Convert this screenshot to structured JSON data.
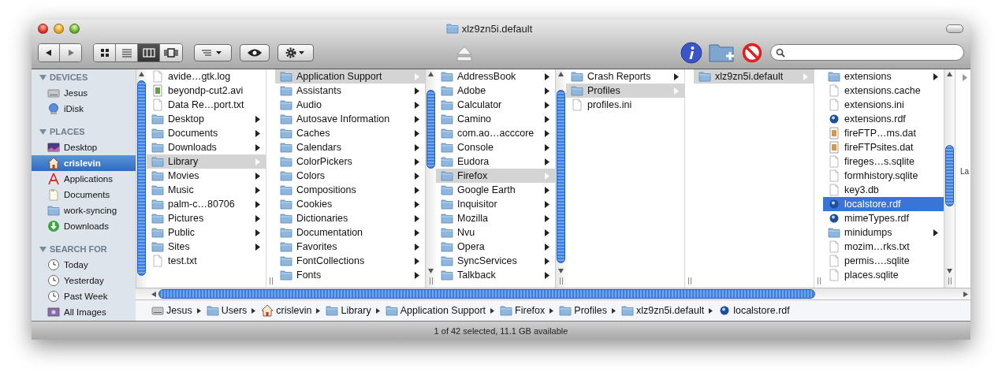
{
  "window": {
    "title": "xlz9zn5i.default"
  },
  "toolbar": {
    "view_modes": [
      {
        "kind": "icons",
        "selected": false
      },
      {
        "kind": "list",
        "selected": false
      },
      {
        "kind": "columns",
        "selected": true
      },
      {
        "kind": "coverflow",
        "selected": false
      }
    ]
  },
  "sidebar": {
    "sections": [
      {
        "title": "DEVICES",
        "expanded": true,
        "items": [
          {
            "label": "Jesus",
            "kind": "drive",
            "selected": false
          },
          {
            "label": "iDisk",
            "kind": "idisk",
            "selected": false
          }
        ]
      },
      {
        "title": "PLACES",
        "expanded": true,
        "items": [
          {
            "label": "Desktop",
            "kind": "desktop",
            "selected": false
          },
          {
            "label": "crislevin",
            "kind": "home",
            "selected": true
          },
          {
            "label": "Applications",
            "kind": "apps",
            "selected": false
          },
          {
            "label": "Documents",
            "kind": "docs",
            "selected": false
          },
          {
            "label": "work-syncing",
            "kind": "folder",
            "selected": false
          },
          {
            "label": "Downloads",
            "kind": "download",
            "selected": false
          }
        ]
      },
      {
        "title": "SEARCH FOR",
        "expanded": true,
        "items": [
          {
            "label": "Today",
            "kind": "clock",
            "selected": false
          },
          {
            "label": "Yesterday",
            "kind": "clock",
            "selected": false
          },
          {
            "label": "Past Week",
            "kind": "clock",
            "selected": false
          },
          {
            "label": "All Images",
            "kind": "images",
            "selected": false
          }
        ]
      }
    ]
  },
  "columns": [
    {
      "focused": false,
      "items": [
        {
          "name": "avide…gtk.log",
          "kind": "file",
          "expandable": false,
          "selected": false
        },
        {
          "name": "beyondp-cut2.avi",
          "kind": "movie",
          "expandable": false,
          "selected": false
        },
        {
          "name": "Data Re…port.txt",
          "kind": "file",
          "expandable": false,
          "selected": false
        },
        {
          "name": "Desktop",
          "kind": "folder",
          "expandable": true,
          "selected": false
        },
        {
          "name": "Documents",
          "kind": "folder",
          "expandable": true,
          "selected": false
        },
        {
          "name": "Downloads",
          "kind": "folder",
          "expandable": true,
          "selected": false
        },
        {
          "name": "Library",
          "kind": "folder",
          "expandable": true,
          "selected": true
        },
        {
          "name": "Movies",
          "kind": "folder",
          "expandable": true,
          "selected": false
        },
        {
          "name": "Music",
          "kind": "folder",
          "expandable": true,
          "selected": false
        },
        {
          "name": "palm-c…80706",
          "kind": "folder",
          "expandable": true,
          "selected": false
        },
        {
          "name": "Pictures",
          "kind": "folder",
          "expandable": true,
          "selected": false
        },
        {
          "name": "Public",
          "kind": "folder",
          "expandable": true,
          "selected": false
        },
        {
          "name": "Sites",
          "kind": "folder",
          "expandable": true,
          "selected": false
        },
        {
          "name": "test.txt",
          "kind": "file",
          "expandable": false,
          "selected": false
        }
      ]
    },
    {
      "focused": false,
      "items": [
        {
          "name": "Application Support",
          "kind": "folder",
          "expandable": true,
          "selected": true
        },
        {
          "name": "Assistants",
          "kind": "folder",
          "expandable": true,
          "selected": false
        },
        {
          "name": "Audio",
          "kind": "folder",
          "expandable": true,
          "selected": false
        },
        {
          "name": "Autosave Information",
          "kind": "folder",
          "expandable": true,
          "selected": false
        },
        {
          "name": "Caches",
          "kind": "folder",
          "expandable": true,
          "selected": false
        },
        {
          "name": "Calendars",
          "kind": "folder",
          "expandable": true,
          "selected": false
        },
        {
          "name": "ColorPickers",
          "kind": "folder",
          "expandable": true,
          "selected": false
        },
        {
          "name": "Colors",
          "kind": "folder",
          "expandable": true,
          "selected": false
        },
        {
          "name": "Compositions",
          "kind": "folder",
          "expandable": true,
          "selected": false
        },
        {
          "name": "Cookies",
          "kind": "folder",
          "expandable": true,
          "selected": false
        },
        {
          "name": "Dictionaries",
          "kind": "folder",
          "expandable": true,
          "selected": false
        },
        {
          "name": "Documentation",
          "kind": "folder",
          "expandable": true,
          "selected": false
        },
        {
          "name": "Favorites",
          "kind": "folder",
          "expandable": true,
          "selected": false
        },
        {
          "name": "FontCollections",
          "kind": "folder",
          "expandable": true,
          "selected": false
        },
        {
          "name": "Fonts",
          "kind": "folder",
          "expandable": true,
          "selected": false
        }
      ]
    },
    {
      "focused": false,
      "items": [
        {
          "name": "AddressBook",
          "kind": "folder",
          "expandable": true,
          "selected": false
        },
        {
          "name": "Adobe",
          "kind": "folder",
          "expandable": true,
          "selected": false
        },
        {
          "name": "Calculator",
          "kind": "folder",
          "expandable": true,
          "selected": false
        },
        {
          "name": "Camino",
          "kind": "folder",
          "expandable": true,
          "selected": false
        },
        {
          "name": "com.ao…acccore",
          "kind": "folder",
          "expandable": true,
          "selected": false
        },
        {
          "name": "Console",
          "kind": "folder",
          "expandable": true,
          "selected": false
        },
        {
          "name": "Eudora",
          "kind": "folder",
          "expandable": true,
          "selected": false
        },
        {
          "name": "Firefox",
          "kind": "folder",
          "expandable": true,
          "selected": true
        },
        {
          "name": "Google Earth",
          "kind": "folder",
          "expandable": true,
          "selected": false
        },
        {
          "name": "Inquisitor",
          "kind": "folder",
          "expandable": true,
          "selected": false
        },
        {
          "name": "Mozilla",
          "kind": "folder",
          "expandable": true,
          "selected": false
        },
        {
          "name": "Nvu",
          "kind": "folder",
          "expandable": true,
          "selected": false
        },
        {
          "name": "Opera",
          "kind": "folder",
          "expandable": true,
          "selected": false
        },
        {
          "name": "SyncServices",
          "kind": "folder",
          "expandable": true,
          "selected": false
        },
        {
          "name": "Talkback",
          "kind": "folder",
          "expandable": true,
          "selected": false
        }
      ]
    },
    {
      "focused": false,
      "items": [
        {
          "name": "Crash Reports",
          "kind": "folder",
          "expandable": true,
          "selected": false
        },
        {
          "name": "Profiles",
          "kind": "folder",
          "expandable": true,
          "selected": true
        },
        {
          "name": "profiles.ini",
          "kind": "file",
          "expandable": false,
          "selected": false
        }
      ]
    },
    {
      "focused": false,
      "items": [
        {
          "name": "xlz9zn5i.default",
          "kind": "folder",
          "expandable": true,
          "selected": true
        }
      ]
    },
    {
      "focused": true,
      "items": [
        {
          "name": "extensions",
          "kind": "folder",
          "expandable": true,
          "selected": false
        },
        {
          "name": "extensions.cache",
          "kind": "file",
          "expandable": false,
          "selected": false
        },
        {
          "name": "extensions.ini",
          "kind": "file",
          "expandable": false,
          "selected": false
        },
        {
          "name": "extensions.rdf",
          "kind": "rdf",
          "expandable": false,
          "selected": false
        },
        {
          "name": "fireFTP…ms.dat",
          "kind": "imgdoc",
          "expandable": false,
          "selected": false
        },
        {
          "name": "fireFTPsites.dat",
          "kind": "imgdoc",
          "expandable": false,
          "selected": false
        },
        {
          "name": "fireges…s.sqlite",
          "kind": "file",
          "expandable": false,
          "selected": false
        },
        {
          "name": "formhistory.sqlite",
          "kind": "file",
          "expandable": false,
          "selected": false
        },
        {
          "name": "key3.db",
          "kind": "file",
          "expandable": false,
          "selected": false
        },
        {
          "name": "localstore.rdf",
          "kind": "rdf",
          "expandable": false,
          "selected": true
        },
        {
          "name": "mimeTypes.rdf",
          "kind": "rdf",
          "expandable": false,
          "selected": false
        },
        {
          "name": "minidumps",
          "kind": "folder",
          "expandable": true,
          "selected": false
        },
        {
          "name": "mozim…rks.txt",
          "kind": "file",
          "expandable": false,
          "selected": false
        },
        {
          "name": "permis….sqlite",
          "kind": "file",
          "expandable": false,
          "selected": false
        },
        {
          "name": "places.sqlite",
          "kind": "file",
          "expandable": false,
          "selected": false
        }
      ]
    }
  ],
  "preview": {
    "text": "La"
  },
  "path_bar": [
    {
      "label": "Jesus",
      "kind": "drive"
    },
    {
      "label": "Users",
      "kind": "folder"
    },
    {
      "label": "crislevin",
      "kind": "home"
    },
    {
      "label": "Library",
      "kind": "folder"
    },
    {
      "label": "Application Support",
      "kind": "folder"
    },
    {
      "label": "Firefox",
      "kind": "folder"
    },
    {
      "label": "Profiles",
      "kind": "folder"
    },
    {
      "label": "xlz9zn5i.default",
      "kind": "folder"
    },
    {
      "label": "localstore.rdf",
      "kind": "rdf"
    }
  ],
  "status_bar": {
    "text": "1 of 42 selected, 11.1 GB available"
  }
}
